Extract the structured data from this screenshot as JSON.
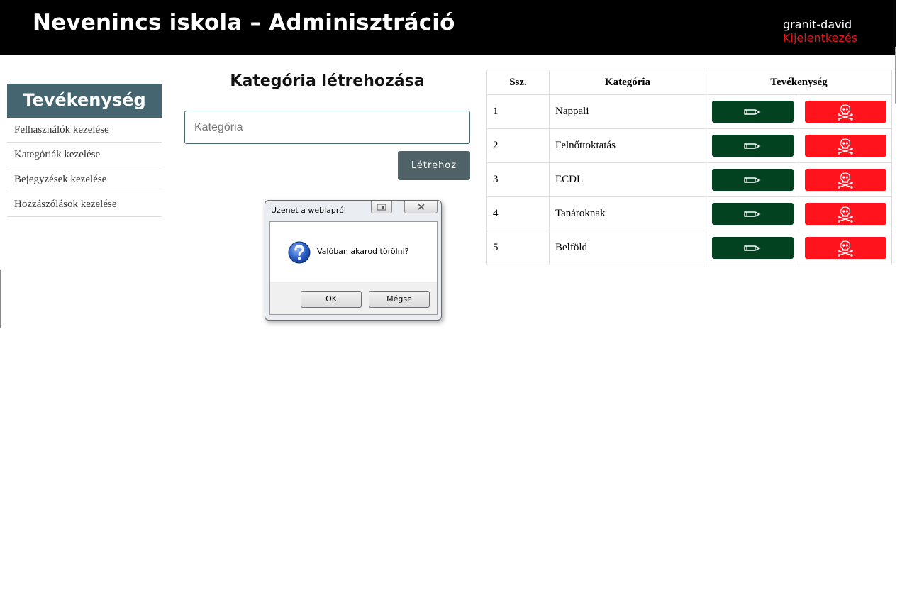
{
  "header": {
    "title": "Nevenincs iskola – Adminisztráció",
    "username": "granit-david",
    "logout_label": "Kijelentkezés"
  },
  "sidebar": {
    "title": "Tevékenység",
    "items": [
      {
        "label": "Felhasználók kezelése"
      },
      {
        "label": "Kategóriák kezelése"
      },
      {
        "label": "Bejegyzések kezelése"
      },
      {
        "label": "Hozzászólások kezelése"
      }
    ]
  },
  "create_form": {
    "title": "Kategória létrehozása",
    "input_placeholder": "Kategória",
    "input_value": "",
    "submit_label": "Létrehoz"
  },
  "table": {
    "headers": [
      "Ssz.",
      "Kategória",
      "Tevékenység"
    ],
    "rows": [
      {
        "num": "1",
        "name": "Nappali"
      },
      {
        "num": "2",
        "name": "Felnőttoktatás"
      },
      {
        "num": "3",
        "name": "ECDL"
      },
      {
        "num": "4",
        "name": "Tanároknak"
      },
      {
        "num": "5",
        "name": "Belföld"
      }
    ],
    "edit_icon": "pencil-icon",
    "delete_icon": "skull-crossbones-icon",
    "edit_color": "#034220",
    "delete_color": "#ff131d"
  },
  "dialog": {
    "title": "Üzenet a weblapról",
    "message": "Valóban akarod törölni?",
    "ok_label": "OK",
    "cancel_label": "Mégse",
    "icon": "question-icon"
  },
  "colors": {
    "header_bg": "#000000",
    "accent": "#456670",
    "logout": "#e5141b"
  }
}
